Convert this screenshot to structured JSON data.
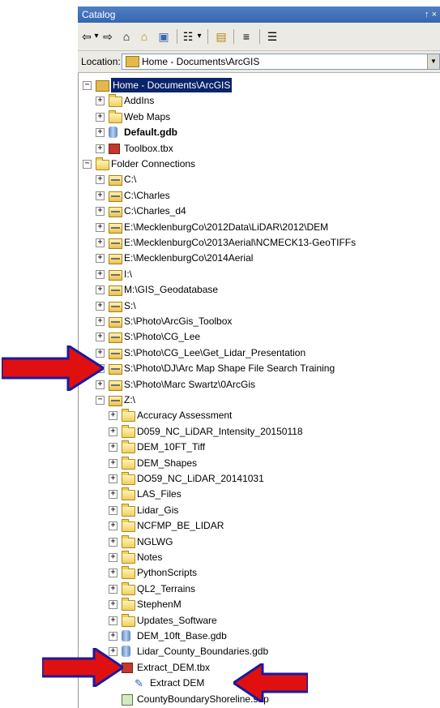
{
  "window": {
    "title": "Catalog",
    "pin": "↑ ×"
  },
  "toolbar": {
    "back": "⇦",
    "back_dd": "▾",
    "forward": "⇨",
    "up": "⌂",
    "home": "⌂",
    "connect": "▣",
    "views": "☷",
    "views_dd": "▾",
    "add_folder": "▤",
    "tree": "≡",
    "options": "☰"
  },
  "location": {
    "label": "Location:",
    "value": "Home - Documents\\ArcGIS"
  },
  "tree": [
    {
      "label": "Home - Documents\\ArcGIS",
      "icon": "home",
      "level": 0,
      "expander": "−",
      "selected": true
    },
    {
      "label": "AddIns",
      "icon": "folder",
      "level": 1,
      "expander": "+"
    },
    {
      "label": "Web Maps",
      "icon": "folder",
      "level": 1,
      "expander": "+"
    },
    {
      "label": "Default.gdb",
      "icon": "gdb",
      "level": 1,
      "expander": "+",
      "bold": true
    },
    {
      "label": "Toolbox.tbx",
      "icon": "tbx",
      "level": 1,
      "expander": "+"
    },
    {
      "label": "Folder Connections",
      "icon": "folder",
      "level": 0,
      "expander": "−"
    },
    {
      "label": "C:\\",
      "icon": "drive",
      "level": 1,
      "expander": "+"
    },
    {
      "label": "C:\\Charles",
      "icon": "drive",
      "level": 1,
      "expander": "+"
    },
    {
      "label": "C:\\Charles_d4",
      "icon": "drive",
      "level": 1,
      "expander": "+"
    },
    {
      "label": "E:\\MecklenburgCo\\2012Data\\LiDAR\\2012\\DEM",
      "icon": "drive",
      "level": 1,
      "expander": "+"
    },
    {
      "label": "E:\\MecklenburgCo\\2013Aerial\\NCMECK13-GeoTIFFs",
      "icon": "drive",
      "level": 1,
      "expander": "+"
    },
    {
      "label": "E:\\MecklenburgCo\\2014Aerial",
      "icon": "drive",
      "level": 1,
      "expander": "+"
    },
    {
      "label": "I:\\",
      "icon": "drive",
      "level": 1,
      "expander": "+"
    },
    {
      "label": "M:\\GIS_Geodatabase",
      "icon": "drive",
      "level": 1,
      "expander": "+"
    },
    {
      "label": "S:\\",
      "icon": "drive",
      "level": 1,
      "expander": "+"
    },
    {
      "label": "S:\\Photo\\ArcGis_Toolbox",
      "icon": "drive",
      "level": 1,
      "expander": "+"
    },
    {
      "label": "S:\\Photo\\CG_Lee",
      "icon": "drive",
      "level": 1,
      "expander": "+"
    },
    {
      "label": "S:\\Photo\\CG_Lee\\Get_Lidar_Presentation",
      "icon": "drive",
      "level": 1,
      "expander": "+"
    },
    {
      "label": "S:\\Photo\\DJ\\Arc Map Shape File Search Training",
      "icon": "drive",
      "level": 1,
      "expander": "+"
    },
    {
      "label": "S:\\Photo\\Marc Swartz\\0ArcGis",
      "icon": "drive",
      "level": 1,
      "expander": "+"
    },
    {
      "label": "Z:\\",
      "icon": "drive",
      "level": 1,
      "expander": "−"
    },
    {
      "label": "Accuracy Assessment",
      "icon": "folder",
      "level": 2,
      "expander": "+"
    },
    {
      "label": "D059_NC_LiDAR_Intensity_20150118",
      "icon": "folder",
      "level": 2,
      "expander": "+"
    },
    {
      "label": "DEM_10FT_Tiff",
      "icon": "folder",
      "level": 2,
      "expander": "+"
    },
    {
      "label": "DEM_Shapes",
      "icon": "folder",
      "level": 2,
      "expander": "+"
    },
    {
      "label": "DO59_NC_LiDAR_20141031",
      "icon": "folder",
      "level": 2,
      "expander": "+"
    },
    {
      "label": "LAS_Files",
      "icon": "folder",
      "level": 2,
      "expander": "+"
    },
    {
      "label": "Lidar_Gis",
      "icon": "folder",
      "level": 2,
      "expander": "+"
    },
    {
      "label": "NCFMP_BE_LIDAR",
      "icon": "folder",
      "level": 2,
      "expander": "+"
    },
    {
      "label": "NGLWG",
      "icon": "folder",
      "level": 2,
      "expander": "+"
    },
    {
      "label": "Notes",
      "icon": "folder",
      "level": 2,
      "expander": "+"
    },
    {
      "label": "PythonScripts",
      "icon": "folder",
      "level": 2,
      "expander": "+"
    },
    {
      "label": "QL2_Terrains",
      "icon": "folder",
      "level": 2,
      "expander": "+"
    },
    {
      "label": "StephenM",
      "icon": "folder",
      "level": 2,
      "expander": "+"
    },
    {
      "label": "Updates_Software",
      "icon": "folder",
      "level": 2,
      "expander": "+"
    },
    {
      "label": "DEM_10ft_Base.gdb",
      "icon": "gdb",
      "level": 2,
      "expander": "+"
    },
    {
      "label": "Lidar_County_Boundaries.gdb",
      "icon": "gdb",
      "level": 2,
      "expander": "+"
    },
    {
      "label": "Extract_DEM.tbx",
      "icon": "tbx",
      "level": 2,
      "expander": "−"
    },
    {
      "label": "Extract DEM",
      "icon": "tool",
      "level": 3,
      "expander": ""
    },
    {
      "label": "CountyBoundaryShoreline.shp",
      "icon": "shp",
      "level": 2,
      "expander": ""
    }
  ],
  "colors": {
    "title_bar": "#3566b0",
    "selection": "#0a246a",
    "arrow": "#e01010",
    "folder": "#f2cf5c"
  }
}
